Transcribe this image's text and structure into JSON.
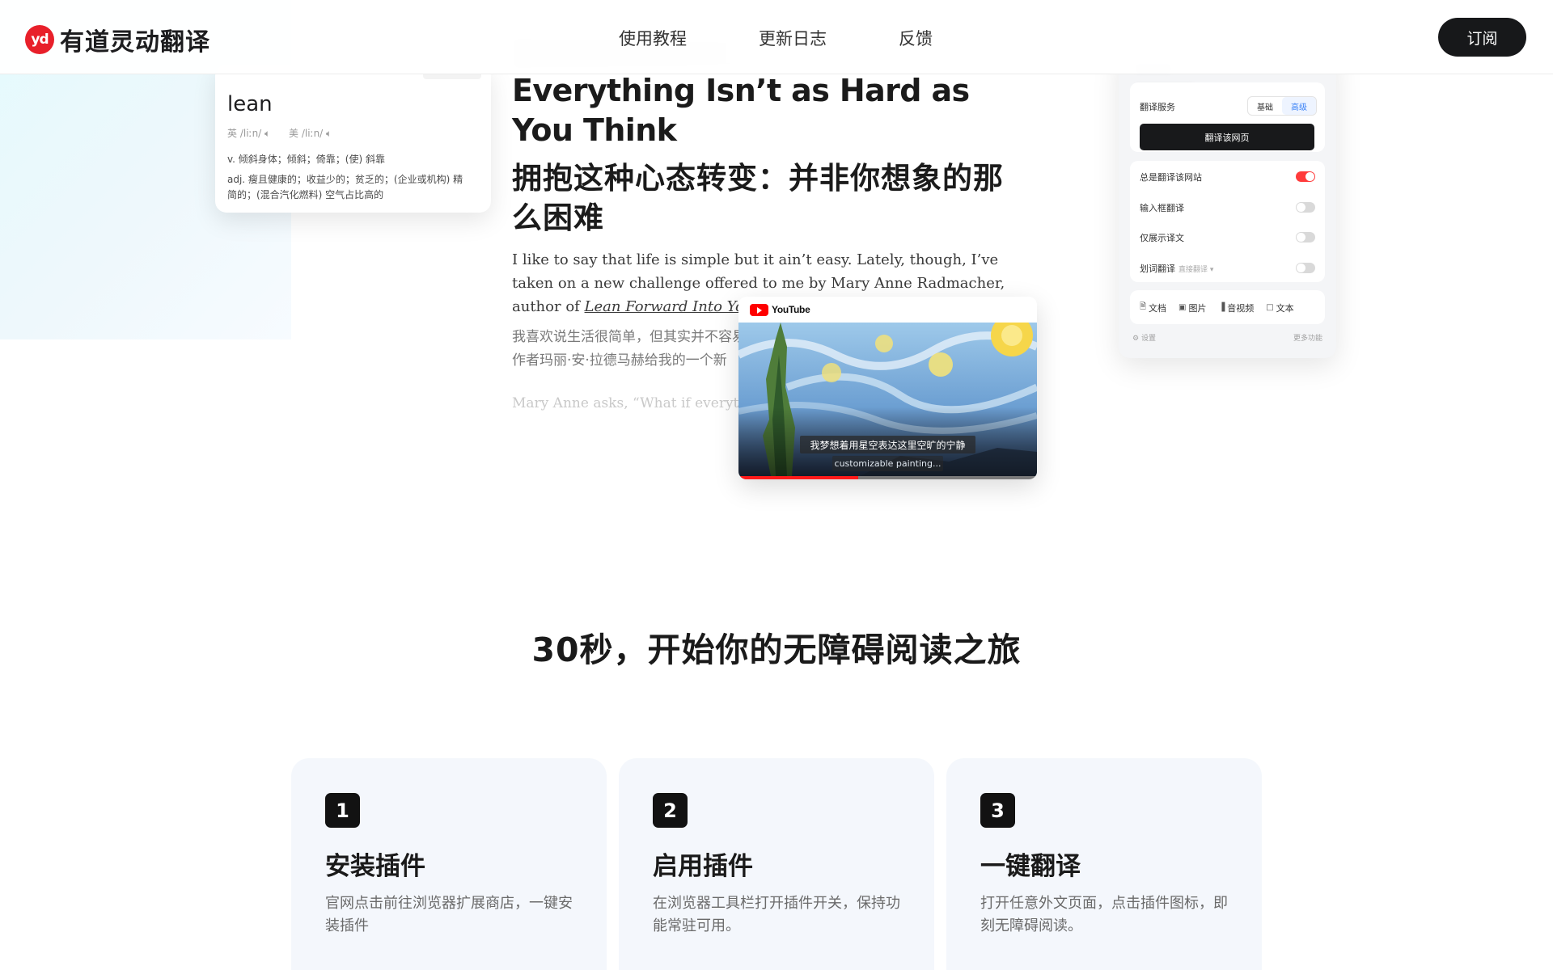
{
  "header": {
    "logo_mark": "yd",
    "brand": "有道灵动翻译",
    "nav": [
      "使用教程",
      "更新日志",
      "反馈"
    ],
    "subscribe": "订阅"
  },
  "dict_card": {
    "word": "lean",
    "phonetic_uk": "英 /liːn/",
    "phonetic_us": "美 /liːn/",
    "def_v": "v. 倾斜身体；倾斜；倚靠；(使) 斜靠",
    "def_adj": "adj. 瘦且健康的；收益少的；贫乏的；(企业或机构) 精简的；(混合汽化燃料) 空气占比高的"
  },
  "article": {
    "title_en": "Everything Isn’t as Hard as You Think",
    "title_zh": "拥抱这种心态转变：并非你想象的那么困难",
    "body_en_pre": "I like to say that life is simple but it ain’t easy. Lately, though, I’ve taken on a new challenge offered to me by Mary Anne Radmacher, author of ",
    "body_en_link": "Lean Forward Into Your Life.",
    "body_zh_1": "我喜欢说生活很简单，但其实并不容易",
    "body_zh_2": "作者玛丽·安·拉德马赫给我的一个新",
    "body_fade": "Mary Anne asks, “What if everything"
  },
  "youtube": {
    "brand": "YouTube",
    "subtitle_zh": "我梦想着用星空表达这里空旷的宁静",
    "subtitle_en": "customizable painting...",
    "progress": 0.4
  },
  "extension": {
    "service_label": "翻译服务",
    "mode_basic": "基础",
    "mode_advanced": "高级",
    "translate_page": "翻译该网页",
    "always_translate": "总是翻译该网站",
    "input_translate": "输入框翻译",
    "only_translation": "仅展示译文",
    "select_translate": "划词翻译",
    "select_hint": "直接翻译 ▾",
    "tools": [
      {
        "icon": "document-icon",
        "label": "文档"
      },
      {
        "icon": "image-icon",
        "label": "图片"
      },
      {
        "icon": "audio-video-icon",
        "label": "音视频"
      },
      {
        "icon": "text-icon",
        "label": "文本"
      }
    ],
    "settings": "设置",
    "more": "更多功能"
  },
  "section": {
    "title": "30秒，开始你的无障碍阅读之旅"
  },
  "steps": [
    {
      "num": "1",
      "title": "安装插件",
      "desc": "官网点击前往浏览器扩展商店，一键安装插件"
    },
    {
      "num": "2",
      "title": "启用插件",
      "desc": "在浏览器工具栏打开插件开关，保持功能常驻可用。"
    },
    {
      "num": "3",
      "title": "一键翻译",
      "desc": "打开任意外文页面，点击插件图标，即刻无障碍阅读。"
    }
  ],
  "colors": {
    "brand_red": "#e8202a",
    "dark_button": "#17181a",
    "toggle_on": "#ff3b3b",
    "card_bg": "#f4f7fc"
  }
}
